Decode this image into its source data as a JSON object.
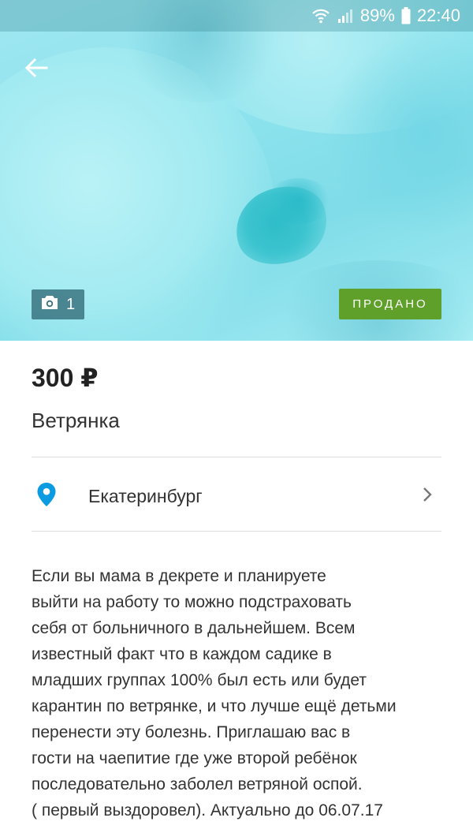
{
  "status_bar": {
    "battery": "89%",
    "time": "22:40"
  },
  "photo": {
    "count": "1"
  },
  "badge": {
    "sold": "ПРОДАНО"
  },
  "listing": {
    "price": "300 ₽",
    "title": "Ветрянка",
    "location": "Екатеринбург",
    "description_lines": [
      "Если вы мама в декрете и планируете",
      "выйти на работу то можно подстраховать",
      "себя от больничного в дальнейшем. Всем",
      "известный факт что в каждом садике в",
      "младших группах 100% был есть или будет",
      "карантин по ветрянке, и что лучше ещё детьми",
      "перенести эту болезнь. Приглашаю вас в",
      "гости на чаепитие где уже второй ребёнок",
      "последовательно заболел ветряной оспой.",
      "( первый выздоровел). Актуально до 06.07.17"
    ]
  },
  "colors": {
    "sold_badge": "#5ea02a",
    "location_pin": "#0a9be0",
    "photo_tint": "#8fe4ee"
  },
  "icons": {
    "back": "arrow-left-icon",
    "camera": "camera-icon",
    "location": "map-pin-icon",
    "chevron": "chevron-right-icon",
    "wifi": "wifi-icon",
    "signal": "signal-icon",
    "battery": "battery-icon"
  }
}
